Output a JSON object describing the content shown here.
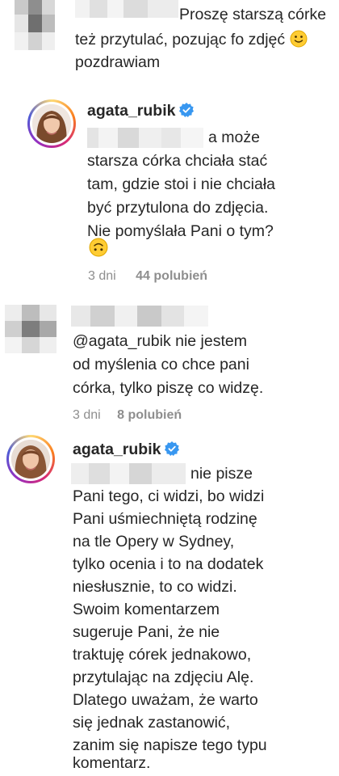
{
  "comments": [
    {
      "user_hidden": true,
      "lines": [
        "Proszę starszą córke",
        "też przytulać, pozując fo zdjęć",
        "pozdrawiam"
      ],
      "emoji": "slightly-smiling-face"
    },
    {
      "username": "agata_rubik",
      "verified": true,
      "lines": [
        "a może",
        "starsza córka chciała stać",
        "tam, gdzie stoi i nie chciała",
        "być przytulona do zdjęcia.",
        "Nie pomyślała Pani o tym?"
      ],
      "emoji": "upside-down-face",
      "time": "3 dni",
      "likes": "44 polubień"
    },
    {
      "user_hidden": true,
      "lines": [
        "@agata_rubik nie jestem",
        "od myślenia co chce pani",
        "córka, tylko piszę co widzę."
      ],
      "time": "3 dni",
      "likes": "8 polubień"
    },
    {
      "username": "agata_rubik",
      "verified": true,
      "lines": [
        "nie pisze",
        "Pani tego, ci widzi, bo widzi",
        "Pani uśmiechniętą rodzinę",
        "na tle Opery w Sydney,",
        "tylko ocenia i to na dodatek",
        "niesłusznie, to co widzi.",
        "Swoim komentarzem",
        "sugeruje Pani, że nie",
        "traktuję córek jednakowo,",
        "przytulając na zdjęciu Alę.",
        "Dlatego uważam, że warto",
        "się jednak zastanowić,",
        "zanim się napisze tego typu",
        "komentarz."
      ]
    }
  ],
  "colors": {
    "verified": "#3897f0",
    "meta": "#8e8e8e",
    "text": "#262626",
    "emoji": "#ffcc33"
  }
}
